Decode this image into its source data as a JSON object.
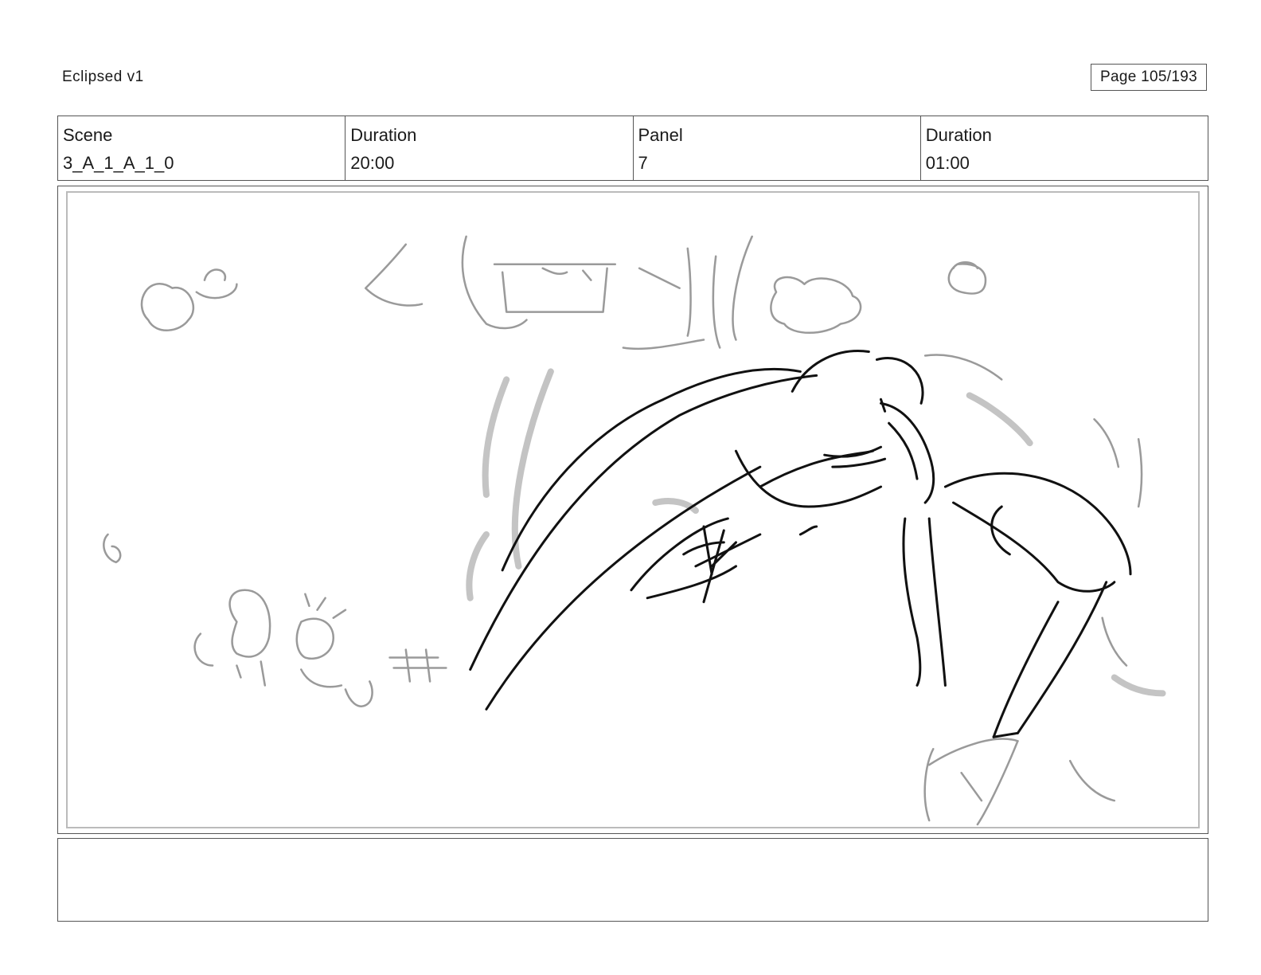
{
  "header": {
    "title": "Eclipsed v1",
    "page_label": "Page 105/193"
  },
  "info": {
    "scene_label": "Scene",
    "scene_value": "3_A_1_A_1_0",
    "duration_label": "Duration",
    "duration_value": "20:00",
    "panel_label": "Panel",
    "panel_value": "7",
    "panel_duration_label": "Duration",
    "panel_duration_value": "01:00"
  },
  "notes": {
    "text": ""
  }
}
